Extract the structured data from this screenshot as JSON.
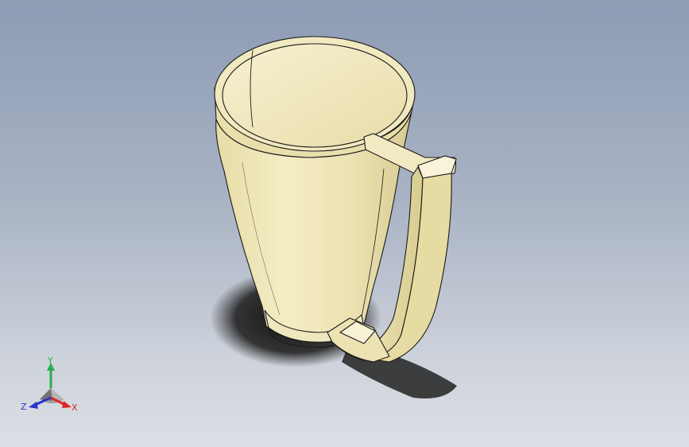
{
  "triad": {
    "y_label": "Y",
    "z_label": "Z",
    "x_label": "X"
  },
  "colors": {
    "background_top": "#8d9bb4",
    "background_bottom": "#dcdfe5",
    "mug_body": "#efe6b6",
    "mug_shade": "#d9cc8f",
    "mug_outline": "#1a1a1a",
    "shadow": "#1b1b1b",
    "axis_y": "#22b14c",
    "axis_x": "#e0242b",
    "axis_z": "#2a35c9"
  },
  "model": {
    "name_icon": "mug-3d-model-icon"
  }
}
